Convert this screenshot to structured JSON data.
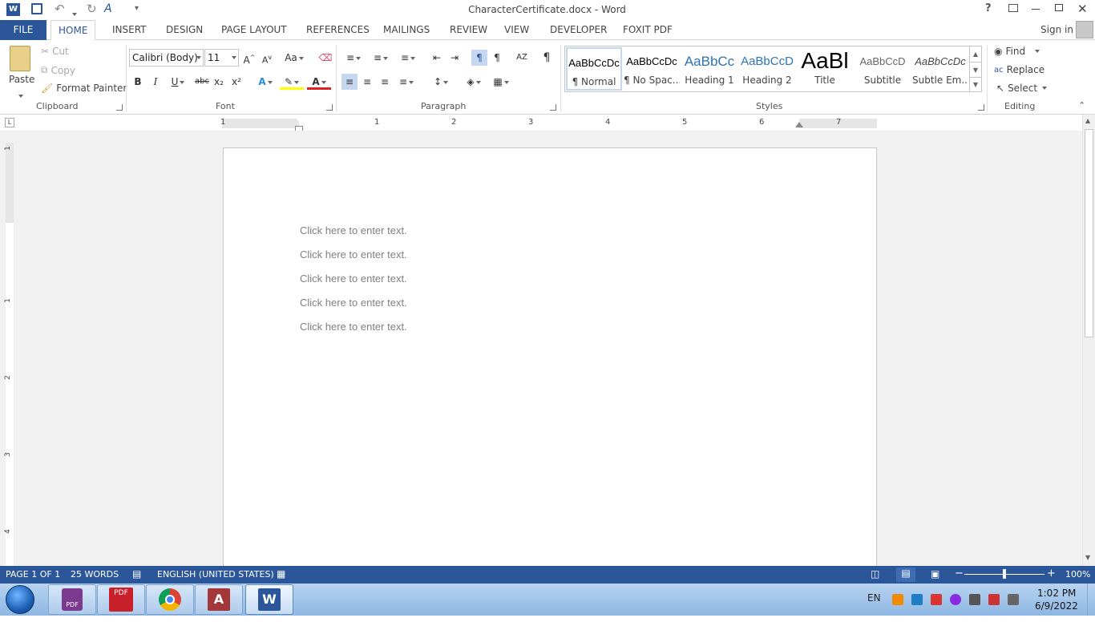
{
  "window": {
    "title": "CharacterCertificate.docx - Word",
    "help": "?",
    "sign_in": "Sign in"
  },
  "tabs": [
    "FILE",
    "HOME",
    "INSERT",
    "DESIGN",
    "PAGE LAYOUT",
    "REFERENCES",
    "MAILINGS",
    "REVIEW",
    "VIEW",
    "DEVELOPER",
    "FOXIT PDF"
  ],
  "active_tab": "HOME",
  "clipboard": {
    "paste": "Paste",
    "cut": "Cut",
    "copy": "Copy",
    "format_painter": "Format Painter",
    "label": "Clipboard"
  },
  "font": {
    "name": "Calibri (Body)",
    "size": "11",
    "bold": "B",
    "italic": "I",
    "underline": "U",
    "strike": "abc",
    "subscript": "x₂",
    "superscript": "x²",
    "case": "Aa",
    "label": "Font"
  },
  "paragraph": {
    "label": "Paragraph",
    "pilcrow": "¶"
  },
  "styles": {
    "items": [
      {
        "preview": "AaBbCcDc",
        "name": "¶ Normal"
      },
      {
        "preview": "AaBbCcDc",
        "name": "¶ No Spac..."
      },
      {
        "preview": "AaBbCc",
        "name": "Heading 1"
      },
      {
        "preview": "AaBbCcD",
        "name": "Heading 2"
      },
      {
        "preview": "AaBl",
        "name": "Title"
      },
      {
        "preview": "AaBbCcD",
        "name": "Subtitle"
      },
      {
        "preview": "AaBbCcDc",
        "name": "Subtle Em..."
      }
    ],
    "label": "Styles"
  },
  "editing": {
    "find": "Find",
    "replace": "Replace",
    "select": "Select",
    "label": "Editing"
  },
  "ruler": {
    "numbers": [
      "1",
      "1",
      "2",
      "3",
      "4",
      "5",
      "6",
      "7"
    ],
    "vnumbers": [
      "1",
      "1",
      "2",
      "3",
      "4"
    ]
  },
  "document": {
    "placeholders": [
      "Click here to enter text.",
      "Click here to enter text.",
      "Click here to enter text.",
      "Click here to enter text.",
      "Click here to enter text."
    ]
  },
  "status": {
    "page": "PAGE 1 OF 1",
    "words": "25 WORDS",
    "language": "ENGLISH (UNITED STATES)",
    "zoom": "100%",
    "zoom_level": 1.0
  },
  "taskbar": {
    "lang": "EN",
    "time": "1:02 PM",
    "date": "6/9/2022",
    "apps": [
      "foxit-reader",
      "pdf-editor",
      "chrome",
      "access",
      "word"
    ]
  },
  "colors": {
    "accent": "#2b579a",
    "taskbar": "#9fc3ea"
  }
}
